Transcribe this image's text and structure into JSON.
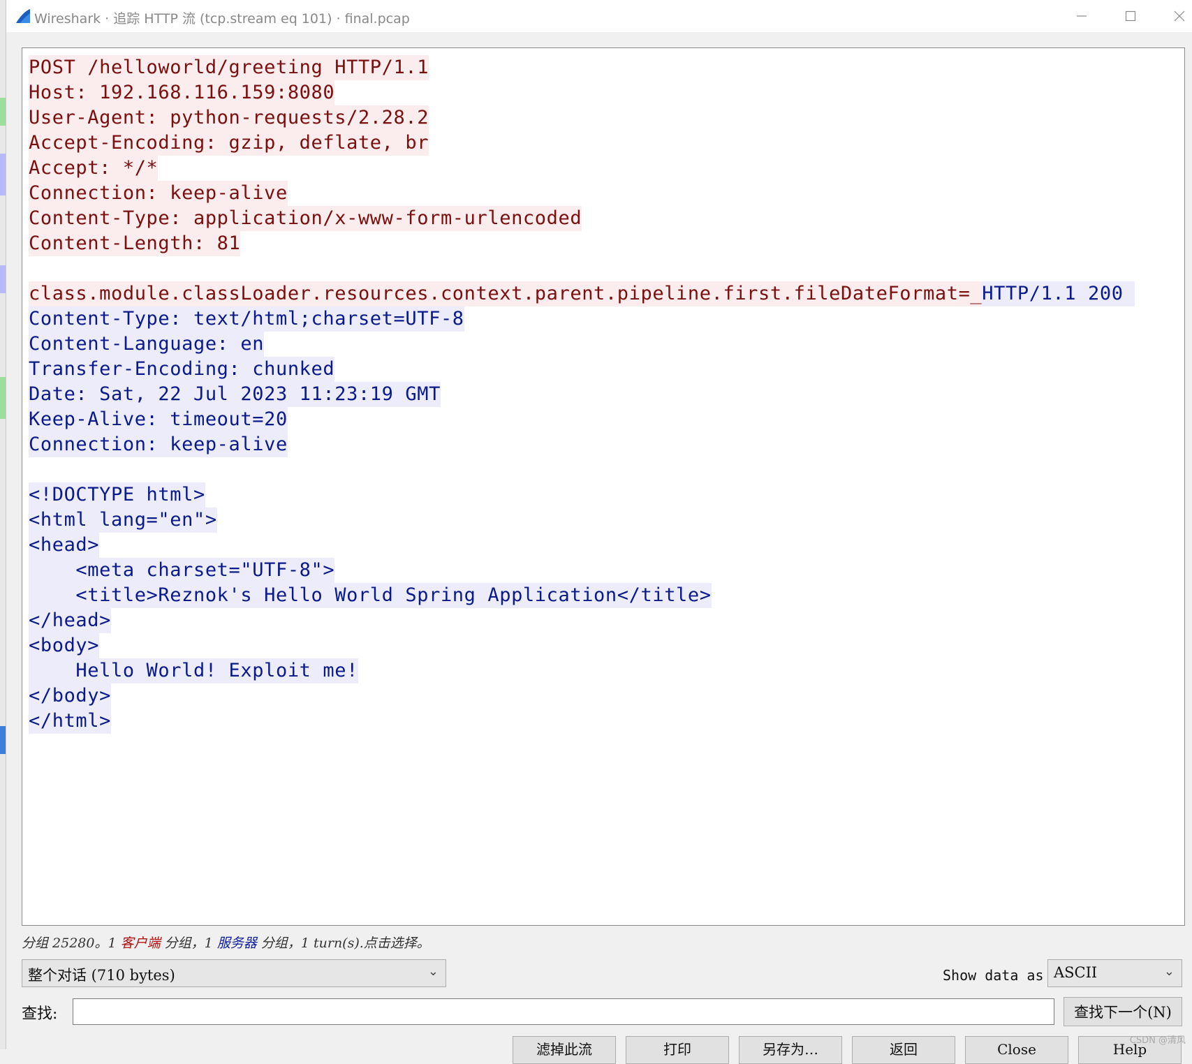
{
  "window": {
    "title": "Wireshark · 追踪 HTTP 流 (tcp.stream eq 101) · final.pcap"
  },
  "stream": {
    "client_color": "#7a0f0f",
    "server_color": "#0a1a8a",
    "lines": [
      [
        {
          "side": "client",
          "text": "POST /helloworld/greeting HTTP/1.1"
        }
      ],
      [
        {
          "side": "client",
          "text": "Host: 192.168.116.159:8080"
        }
      ],
      [
        {
          "side": "client",
          "text": "User-Agent: python-requests/2.28.2"
        }
      ],
      [
        {
          "side": "client",
          "text": "Accept-Encoding: gzip, deflate, br"
        }
      ],
      [
        {
          "side": "client",
          "text": "Accept: */*"
        }
      ],
      [
        {
          "side": "client",
          "text": "Connection: keep-alive"
        }
      ],
      [
        {
          "side": "client",
          "text": "Content-Type: application/x-www-form-urlencoded"
        }
      ],
      [
        {
          "side": "client",
          "text": "Content-Length: 81"
        }
      ],
      [],
      [
        {
          "side": "client",
          "text": "class.module.classLoader.resources.context.parent.pipeline.first.fileDateFormat=_"
        },
        {
          "side": "server",
          "text": "HTTP/1.1 200 "
        }
      ],
      [
        {
          "side": "server",
          "text": "Content-Type: text/html;charset=UTF-8"
        }
      ],
      [
        {
          "side": "server",
          "text": "Content-Language: en"
        }
      ],
      [
        {
          "side": "server",
          "text": "Transfer-Encoding: chunked"
        }
      ],
      [
        {
          "side": "server",
          "text": "Date: Sat, 22 Jul 2023 11:23:19 GMT"
        }
      ],
      [
        {
          "side": "server",
          "text": "Keep-Alive: timeout=20"
        }
      ],
      [
        {
          "side": "server",
          "text": "Connection: keep-alive"
        }
      ],
      [],
      [
        {
          "side": "server",
          "text": "<!DOCTYPE html>"
        }
      ],
      [
        {
          "side": "server",
          "text": "<html lang=\"en\">"
        }
      ],
      [
        {
          "side": "server",
          "text": "<head>"
        }
      ],
      [
        {
          "side": "server",
          "text": "    <meta charset=\"UTF-8\">"
        }
      ],
      [
        {
          "side": "server",
          "text": "    <title>Reznok's Hello World Spring Application</title>"
        }
      ],
      [
        {
          "side": "server",
          "text": "</head>"
        }
      ],
      [
        {
          "side": "server",
          "text": "<body>"
        }
      ],
      [
        {
          "side": "server",
          "text": "    Hello World! Exploit me!"
        }
      ],
      [
        {
          "side": "server",
          "text": "</body>"
        }
      ],
      [
        {
          "side": "server",
          "text": "</html>"
        }
      ]
    ]
  },
  "status": {
    "prefix": "分组 25280。1 ",
    "client_label": "客户端",
    "mid": " 分组，1 ",
    "server_label": "服务器",
    "suffix": " 分组，1 turn(s).点击选择。"
  },
  "conversation": {
    "selected": "整个对话 (710 bytes)"
  },
  "show_data": {
    "label": "Show data as",
    "selected": "ASCII"
  },
  "find": {
    "label": "查找:",
    "value": "",
    "next_button": "查找下一个(N)"
  },
  "buttons": [
    "滤掉此流",
    "打印",
    "另存为…",
    "返回",
    "Close",
    "Help"
  ],
  "watermark": "CSDN @清风"
}
